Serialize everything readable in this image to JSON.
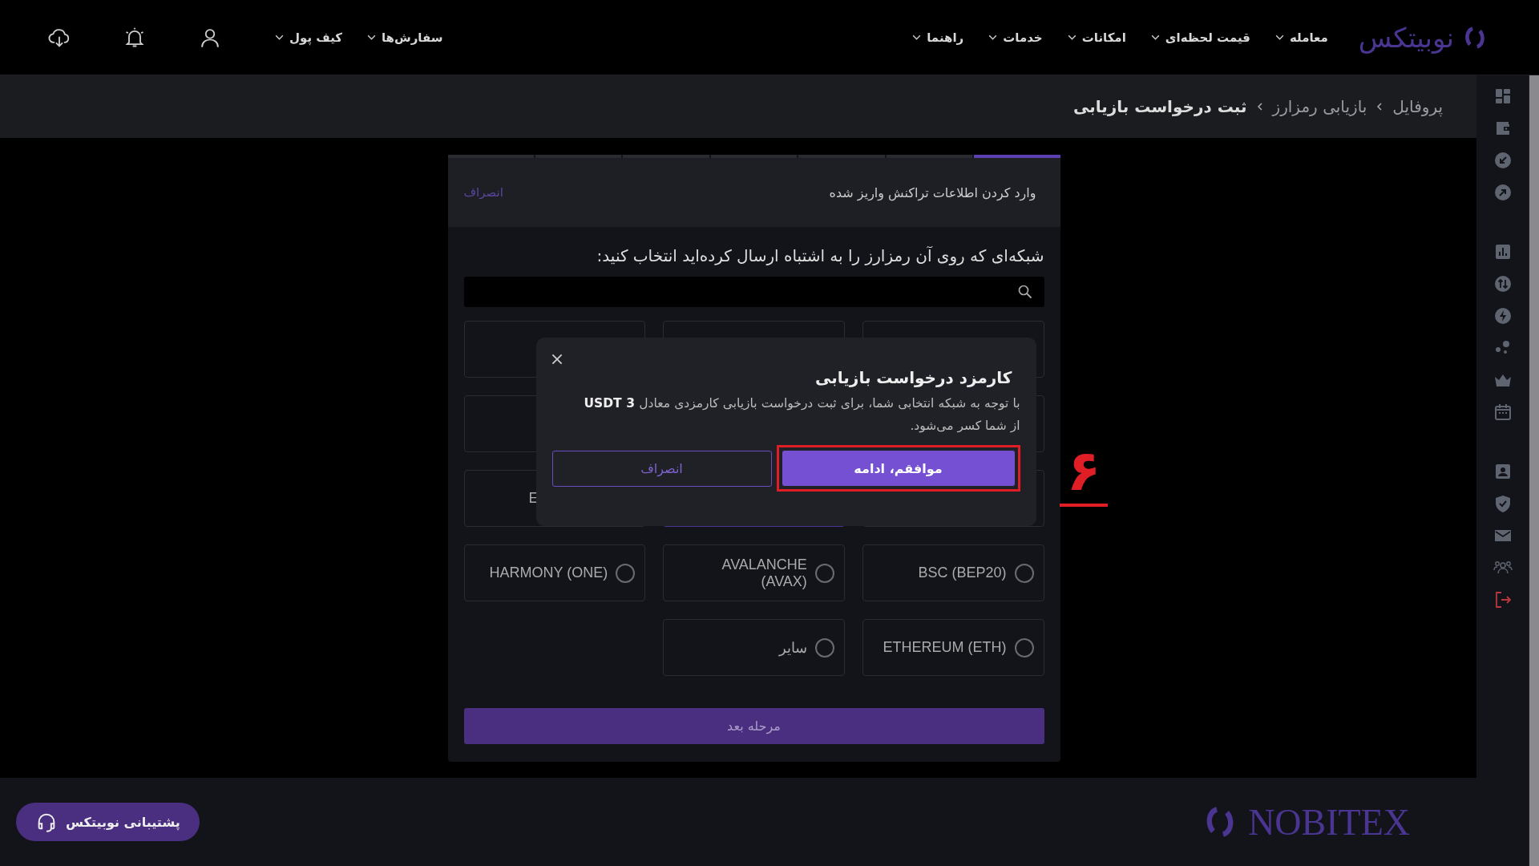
{
  "header": {
    "logo": "نوبیتکس",
    "nav": [
      {
        "label": "معامله"
      },
      {
        "label": "قیمت لحظه‌ای"
      },
      {
        "label": "امکانات"
      },
      {
        "label": "خدمات"
      },
      {
        "label": "راهنما"
      }
    ],
    "user_menus": [
      {
        "label": "سفارش‌ها"
      },
      {
        "label": "کیف پول"
      }
    ]
  },
  "breadcrumb": [
    {
      "label": "پروفایل",
      "current": false
    },
    {
      "label": "بازیابی رمزارز",
      "current": false
    },
    {
      "label": "ثبت درخواست بازیابی",
      "current": true
    }
  ],
  "steps": [
    {
      "active": true
    },
    {
      "active": false
    },
    {
      "active": false
    },
    {
      "active": false
    },
    {
      "active": false
    },
    {
      "active": false
    },
    {
      "active": false
    }
  ],
  "card": {
    "title": "وارد کردن اطلاعات تراکنش واریز شده",
    "cancel": "انصراف",
    "question": "شبکه‌ای که روی آن رمزارز را به اشتباه ارسال کرده‌اید انتخاب کنید:",
    "next_button": "مرحله بعد"
  },
  "networks": [
    {
      "kind": "hidden"
    },
    {
      "kind": "hidden"
    },
    {
      "kind": "hidden"
    },
    {
      "kind": "hidden"
    },
    {
      "kind": "covered"
    },
    {
      "kind": "hidden"
    },
    {
      "kind": "hidden"
    },
    {
      "kind": "hidden",
      "selected": true
    },
    {
      "kind": "partial",
      "label": "E",
      "selected": false
    },
    {
      "kind": "option",
      "label": "BSC (BEP20)",
      "selected": false
    },
    {
      "kind": "option",
      "label": "AVALANCHE (AVAX)",
      "selected": false
    },
    {
      "kind": "option",
      "label": "HARMONY (ONE)",
      "selected": false
    },
    {
      "kind": "option",
      "label": "ETHEREUM (ETH)",
      "selected": false
    },
    {
      "kind": "option",
      "label": "سایر",
      "selected": false
    }
  ],
  "dialog": {
    "title": "کارمزد درخواست بازیابی",
    "body": "با توجه به شبکه انتخابی شما، برای ثبت درخواست بازیابی کارمزدی معادل **3 USDT** از شما کسر می‌شود.",
    "confirm": "موافقم، ادامه",
    "cancel": "انصراف"
  },
  "annotation": {
    "number": "۶"
  },
  "footer": {
    "support": "پشتیبانی نوبیتکس",
    "logo": "NOBITEX"
  }
}
